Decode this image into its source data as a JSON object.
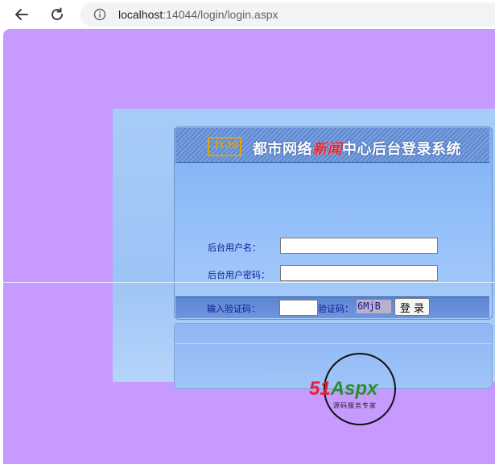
{
  "browser": {
    "url_host": "localhost",
    "url_rest": ":14044/login/login.aspx"
  },
  "login": {
    "banner_title_prefix": "都市网络",
    "banner_title_accent": "新闻",
    "banner_title_suffix": "中心后台登录系统",
    "logo_text": "JYJS",
    "username_label": "后台用户名：",
    "username_value": "",
    "password_label": "后台用户密码：",
    "password_value": "",
    "captcha_input_label": "输入验证码：",
    "captcha_input_value": "",
    "captcha_label": "验证码：",
    "captcha_code": "6MjB",
    "login_button": "登 录"
  },
  "watermark": {
    "brand_red": "51",
    "brand_green": "Aspx",
    "tagline": "源码服务专家"
  },
  "colors": {
    "page_bg": "#c79aff",
    "banner": "#6f97d8",
    "label_text": "#0b1d8c",
    "accent_red": "#e8212c"
  }
}
